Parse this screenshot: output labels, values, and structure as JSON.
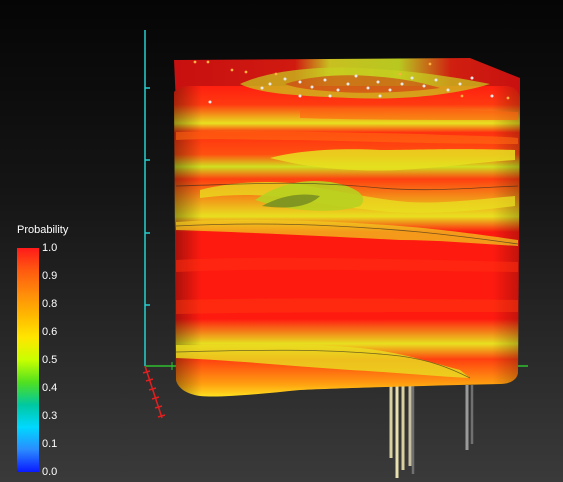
{
  "legend": {
    "title": "Probability",
    "ticks": [
      "1.0",
      "0.9",
      "0.8",
      "0.6",
      "0.5",
      "0.4",
      "0.3",
      "0.1",
      "0.0"
    ]
  },
  "colors": {
    "background_top": "#050505",
    "background_bottom": "#3a3a3a",
    "high_probability": "#ff1a1a",
    "mid_probability": "#ffe600",
    "z_axis": "#26d0d0",
    "x_axis": "#30c030",
    "y_axis": "#e02020",
    "wells": "#d8d0a0"
  }
}
